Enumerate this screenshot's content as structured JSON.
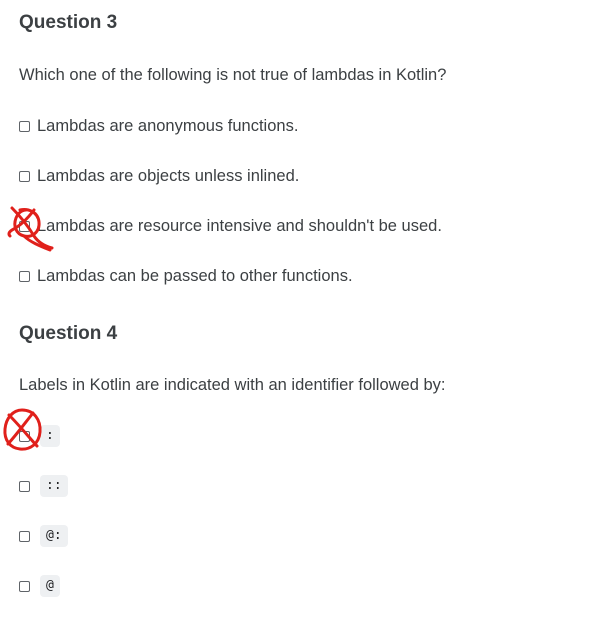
{
  "question3": {
    "heading": "Question 3",
    "prompt": "Which one of the following is not true of lambdas in Kotlin?",
    "options": [
      "Lambdas are anonymous functions.",
      "Lambdas are objects unless inlined.",
      "Lambdas are resource intensive and shouldn't be used.",
      "Lambdas can be passed to other functions."
    ]
  },
  "question4": {
    "heading": "Question 4",
    "prompt": "Labels in Kotlin are indicated with an identifier followed by:",
    "options": [
      ":",
      "::",
      "@:",
      "@"
    ]
  },
  "annotation": {
    "color": "#e0201b",
    "marked_q3_option": 3,
    "marked_q4_option": 1
  }
}
